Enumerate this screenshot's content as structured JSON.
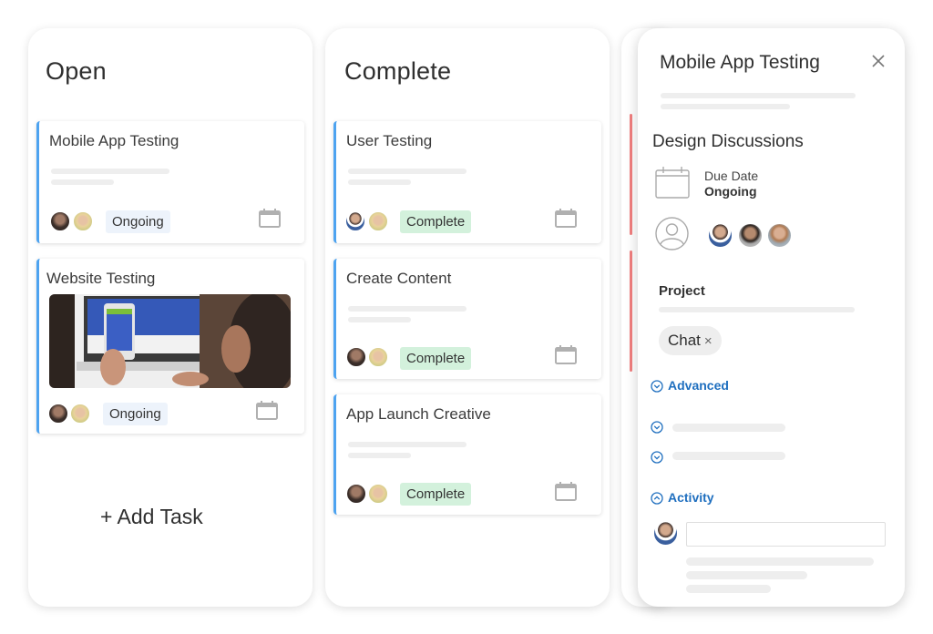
{
  "columns": [
    {
      "title": "Open",
      "cards": [
        {
          "title": "Mobile App Testing",
          "status": "Ongoing",
          "assignees": [
            "avatar-bearded-man",
            "avatar-blonde-woman"
          ]
        },
        {
          "title": "Website Testing",
          "status": "Ongoing",
          "assignees": [
            "avatar-bearded-man",
            "avatar-blonde-woman"
          ],
          "image": "person-testing-website-on-phone-and-laptop"
        }
      ],
      "add_task_label": "+ Add Task"
    },
    {
      "title": "Complete",
      "cards": [
        {
          "title": "User Testing",
          "status": "Complete",
          "assignees": [
            "avatar-man-blue-shirt",
            "avatar-blonde-woman"
          ]
        },
        {
          "title": "Create Content",
          "status": "Complete",
          "assignees": [
            "avatar-bearded-man",
            "avatar-blonde-woman"
          ]
        },
        {
          "title": "App Launch Creative",
          "status": "Complete",
          "assignees": [
            "avatar-bearded-man",
            "avatar-blonde-woman"
          ]
        }
      ]
    }
  ],
  "detail_panel": {
    "title": "Mobile App Testing",
    "close_icon": "close-icon",
    "section_title": "Design Discussions",
    "due_date_label": "Due Date",
    "due_date_value": "Ongoing",
    "assignees": [
      "avatar-man-blue-jacket",
      "avatar-man-smiling",
      "avatar-man-ginger-beard"
    ],
    "project_label": "Project",
    "project_chip": "Chat",
    "chip_remove": "×",
    "advanced_label": "Advanced",
    "activity_label": "Activity",
    "comment_placeholder": ""
  },
  "colors": {
    "card_accent": "#4da3f0",
    "ongoing_badge": "#edf3fb",
    "complete_badge": "#d3f1dc",
    "link_blue": "#1f6fbf",
    "red_accent": "#f07f7f"
  }
}
